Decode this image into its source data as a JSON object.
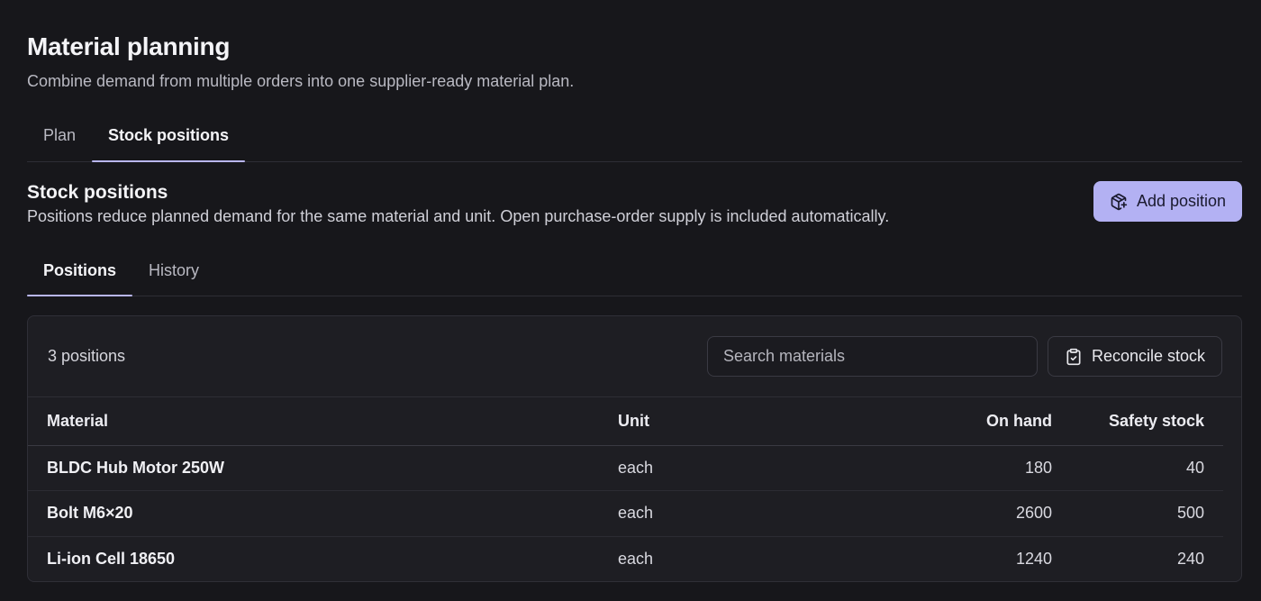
{
  "page": {
    "title": "Material planning",
    "subtitle": "Combine demand from multiple orders into one supplier-ready material plan."
  },
  "top_tabs": [
    {
      "label": "Plan",
      "active": false
    },
    {
      "label": "Stock positions",
      "active": true
    }
  ],
  "section": {
    "title": "Stock positions",
    "description": "Positions reduce planned demand for the same material and unit. Open purchase-order supply is included automatically.",
    "add_button_label": "Add position",
    "add_button_icon": "package-plus-icon"
  },
  "sub_tabs": [
    {
      "label": "Positions",
      "active": true
    },
    {
      "label": "History",
      "active": false
    }
  ],
  "toolbar": {
    "count_label": "3 positions",
    "search_placeholder": "Search materials",
    "search_value": "",
    "reconcile_label": "Reconcile stock",
    "reconcile_icon": "clipboard-check-icon"
  },
  "table": {
    "columns": [
      "Material",
      "Unit",
      "On hand",
      "Safety stock"
    ],
    "rows": [
      {
        "material": "BLDC Hub Motor 250W",
        "unit": "each",
        "on_hand": "180",
        "safety_stock": "40"
      },
      {
        "material": "Bolt M6×20",
        "unit": "each",
        "on_hand": "2600",
        "safety_stock": "500"
      },
      {
        "material": "Li-ion Cell 18650",
        "unit": "each",
        "on_hand": "1240",
        "safety_stock": "240"
      }
    ]
  },
  "colors": {
    "background": "#17171b",
    "accent": "#b3b1f3",
    "card": "#1e1e23"
  }
}
